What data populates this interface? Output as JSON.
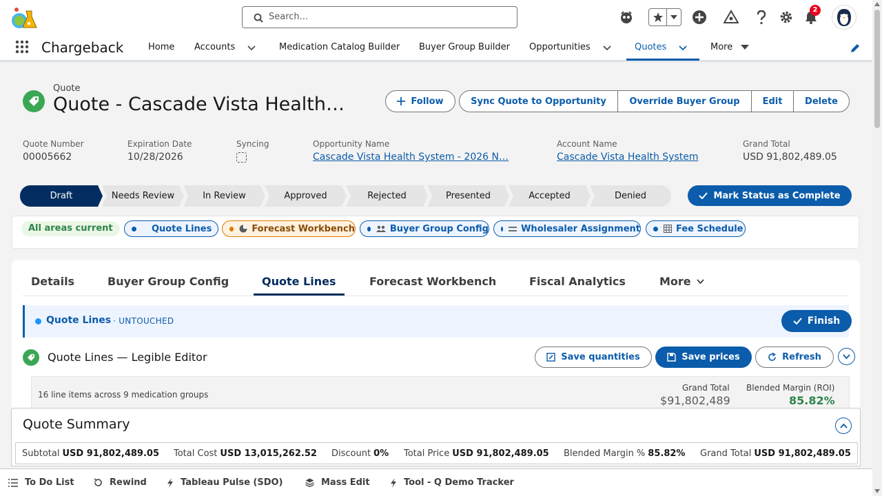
{
  "header": {
    "search_placeholder": "Search...",
    "notification_count": "2"
  },
  "nav": {
    "app_name": "Chargeback",
    "items": [
      {
        "label": "Home"
      },
      {
        "label": "Accounts"
      },
      {
        "label": "Medication Catalog Builder"
      },
      {
        "label": "Buyer Group Builder"
      },
      {
        "label": "Opportunities"
      },
      {
        "label": "Quotes"
      },
      {
        "label": "More"
      }
    ]
  },
  "record": {
    "object_label": "Quote",
    "title": "Quote - Cascade Vista Health…",
    "actions": {
      "follow": "Follow",
      "sync": "Sync Quote to Opportunity",
      "override": "Override Buyer Group",
      "edit": "Edit",
      "delete": "Delete"
    },
    "fields": {
      "quote_number_label": "Quote Number",
      "quote_number": "00005662",
      "expiration_label": "Expiration Date",
      "expiration": "10/28/2026",
      "syncing_label": "Syncing",
      "opportunity_label": "Opportunity Name",
      "opportunity": "Cascade Vista Health System - 2026 N…",
      "account_label": "Account Name",
      "account": "Cascade Vista Health System",
      "grand_total_label": "Grand Total",
      "grand_total": "USD 91,802,489.05"
    }
  },
  "path": {
    "steps": [
      "Draft",
      "Needs Review",
      "In Review",
      "Approved",
      "Rejected",
      "Presented",
      "Accepted",
      "Denied"
    ],
    "current": "Draft",
    "action": "Mark Status as Complete"
  },
  "areas": {
    "status": "All areas current",
    "chips": [
      {
        "label": "Quote Lines",
        "state": "current"
      },
      {
        "label": "Forecast Workbench",
        "state": "attention"
      },
      {
        "label": "Buyer Group Config",
        "state": "current"
      },
      {
        "label": "Wholesaler Assignment",
        "state": "current"
      },
      {
        "label": "Fee Schedule",
        "state": "current"
      }
    ]
  },
  "tabs": {
    "items": [
      "Details",
      "Buyer Group Config",
      "Quote Lines",
      "Forecast Workbench",
      "Fiscal Analytics"
    ],
    "more": "More",
    "active": "Quote Lines"
  },
  "section": {
    "title": "Quote Lines",
    "status": "· UNTOUCHED",
    "finish": "Finish"
  },
  "editor": {
    "title": "Quote Lines — Legible Editor",
    "save_quantities": "Save quantities",
    "save_prices": "Save prices",
    "refresh": "Refresh",
    "line_items_summary": "16 line items across 9 medication groups",
    "grand_total_label": "Grand Total",
    "grand_total": "$91,802,489",
    "margin_label": "Blended Margin (ROI)",
    "margin": "85.82%"
  },
  "quote_summary": {
    "title": "Quote Summary",
    "metrics": [
      {
        "label": "Subtotal",
        "value": "USD 91,802,489.05"
      },
      {
        "label": "Total Cost",
        "value": "USD 13,015,262.52"
      },
      {
        "label": "Discount",
        "value": "0%"
      },
      {
        "label": "Total Price",
        "value": "USD 91,802,489.05"
      },
      {
        "label": "Blended Margin %",
        "value": "85.82%"
      },
      {
        "label": "Grand Total",
        "value": "USD 91,802,489.05"
      }
    ]
  },
  "utility_bar": {
    "items": [
      {
        "label": "To Do List",
        "icon": "list-icon"
      },
      {
        "label": "Rewind",
        "icon": "rewind-icon"
      },
      {
        "label": "Tableau Pulse (SDO)",
        "icon": "bolt-icon"
      },
      {
        "label": "Mass Edit",
        "icon": "layers-icon"
      },
      {
        "label": "Tool - Q Demo Tracker",
        "icon": "bolt-icon"
      }
    ]
  },
  "colors": {
    "brand": "#0b5cab",
    "path_current": "#032d60",
    "success": "#2e844a",
    "warning": "#dd7a01",
    "badge": "#ea001e"
  }
}
